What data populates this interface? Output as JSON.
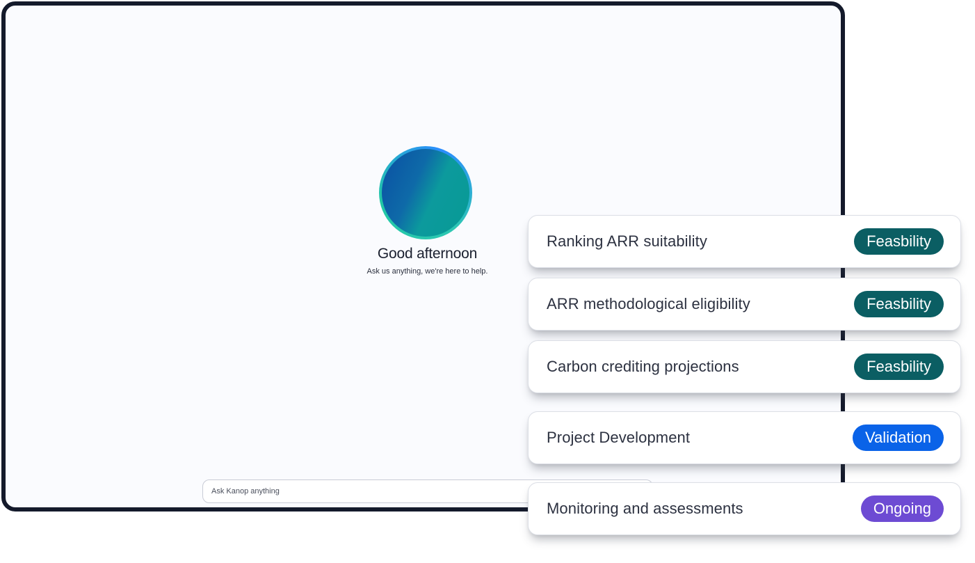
{
  "screen": {
    "greeting": "Good afternoon",
    "subtitle": "Ask us anything, we're here to help.",
    "ask_placeholder": "Ask Kanop anything"
  },
  "cards": [
    {
      "label": "Ranking ARR suitability",
      "badge": "Feasbility",
      "badge_color": "#0b5e63"
    },
    {
      "label": "ARR methodological eligibility",
      "badge": "Feasbility",
      "badge_color": "#0b5e63"
    },
    {
      "label": "Carbon crediting projections",
      "badge": "Feasbility",
      "badge_color": "#0b5e63"
    },
    {
      "label": "Project Development",
      "badge": "Validation",
      "badge_color": "#0a63e8"
    },
    {
      "label": "Monitoring and assessments",
      "badge": "Ongoing",
      "badge_color": "#6d4bd3"
    }
  ]
}
